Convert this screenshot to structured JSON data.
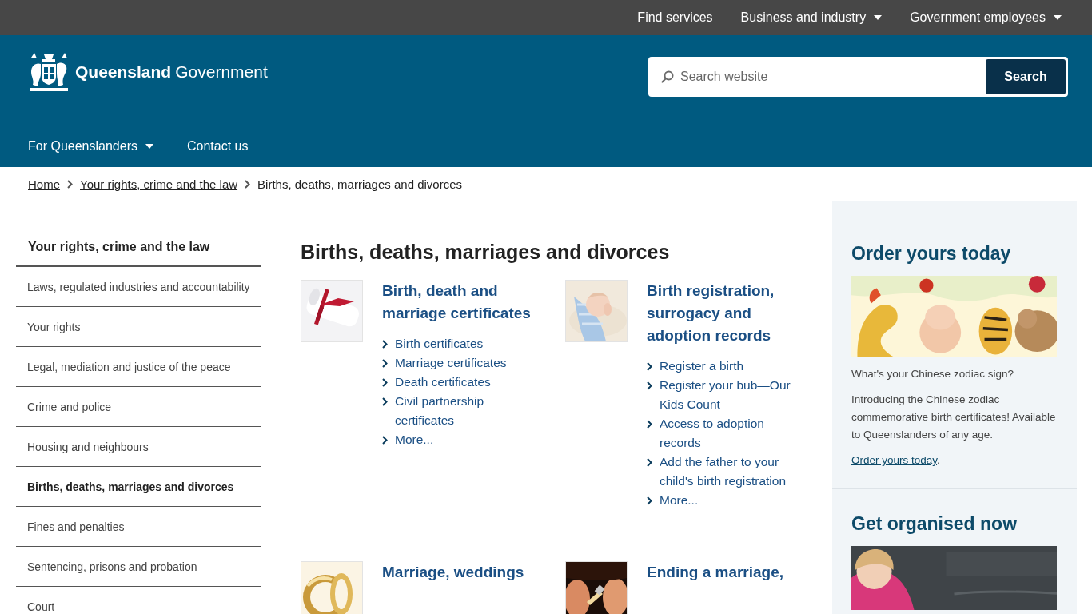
{
  "top_nav": [
    {
      "label": "Find services",
      "dropdown": false
    },
    {
      "label": "Business and industry",
      "dropdown": true
    },
    {
      "label": "Government employees",
      "dropdown": true
    }
  ],
  "brand": {
    "strong": "Queensland",
    "light": "Government"
  },
  "search": {
    "placeholder": "Search website",
    "button": "Search"
  },
  "main_nav": [
    {
      "label": "For Queenslanders",
      "dropdown": true
    },
    {
      "label": "Contact us",
      "dropdown": false
    }
  ],
  "breadcrumb": [
    {
      "label": "Home",
      "link": true
    },
    {
      "label": "Your rights, crime and the law",
      "link": true
    },
    {
      "label": "Births, deaths, marriages and divorces",
      "link": false
    }
  ],
  "sidebar": {
    "title": "Your rights, crime and the law",
    "items": [
      {
        "label": "Laws, regulated industries and accountability",
        "selected": false
      },
      {
        "label": "Your rights",
        "selected": false
      },
      {
        "label": "Legal, mediation and justice of the peace",
        "selected": false
      },
      {
        "label": "Crime and police",
        "selected": false
      },
      {
        "label": "Housing and neighbours",
        "selected": false
      },
      {
        "label": "Births, deaths, marriages and divorces",
        "selected": true
      },
      {
        "label": "Fines and penalties",
        "selected": false
      },
      {
        "label": "Sentencing, prisons and probation",
        "selected": false
      },
      {
        "label": "Court",
        "selected": false
      }
    ]
  },
  "page_title": "Births, deaths, marriages and divorces",
  "cards": [
    {
      "title": "Birth, death and marriage certificates",
      "links": [
        "Birth certificates",
        "Marriage certificates",
        "Death certificates",
        "Civil partnership certificates",
        "More..."
      ]
    },
    {
      "title": "Birth registration, surrogacy and adoption records",
      "links": [
        "Register a birth",
        "Register your bub—Our Kids Count",
        "Access to adoption records",
        "Add the father to your child's birth registration",
        "More..."
      ]
    },
    {
      "title": "Marriage, weddings"
    },
    {
      "title": "Ending a marriage,"
    }
  ],
  "aside": [
    {
      "title": "Order yours today",
      "paragraphs": [
        "What's your Chinese zodiac sign?",
        "Introducing the Chinese zodiac commemorative birth certificates! Available to Queenslanders of any age."
      ],
      "link": "Order yours today",
      "link_trail": "."
    },
    {
      "title": "Get organised now"
    }
  ]
}
